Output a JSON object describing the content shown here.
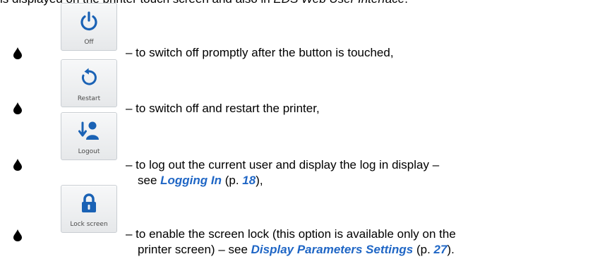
{
  "intro": {
    "text_a": "is displayed on the printer touch screen and also in ",
    "text_b": "EDS Web User Interface",
    "text_c": "."
  },
  "items": [
    {
      "icon": "power-icon",
      "button_label": "Off",
      "desc": "– to switch off promptly after the button is touched,"
    },
    {
      "icon": "restart-icon",
      "button_label": "Restart",
      "desc": "– to switch off and restart the printer,"
    },
    {
      "icon": "logout-user-icon",
      "button_label": "Logout",
      "desc_line1": "– to log out the current user and display the log in display –",
      "desc_line2_a": "see ",
      "ref": "Logging In",
      "desc_line2_b": " (p. ",
      "page": "18",
      "desc_line2_c": "),"
    },
    {
      "icon": "padlock-icon",
      "button_label": "Lock screen",
      "desc_line1": "– to enable the screen lock (this option is available only on the",
      "desc_line2_a": "printer screen) – see ",
      "ref": "Display Parameters Settings",
      "desc_line2_b": " (p. ",
      "page": "27",
      "desc_line2_c": ")."
    }
  ],
  "colors": {
    "icon": "#1a62b5",
    "link": "#1f66c5"
  }
}
